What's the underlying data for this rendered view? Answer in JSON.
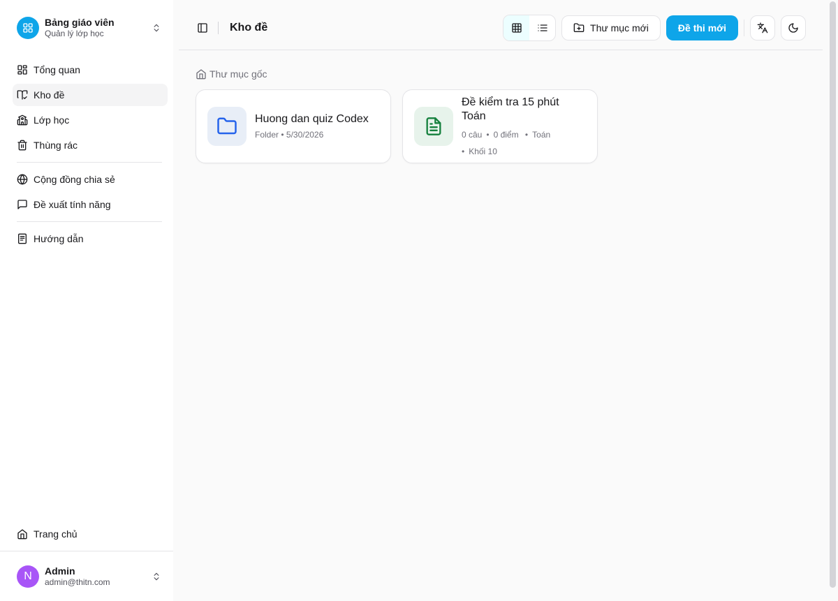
{
  "brand": {
    "title": "Bảng giáo viên",
    "subtitle": "Quản lý lớp học",
    "color": "#0ea5e9"
  },
  "sidebar": {
    "items": [
      {
        "label": "Tổng quan",
        "icon": "dashboard-icon"
      },
      {
        "label": "Kho đề",
        "icon": "book-check-icon",
        "active": true
      },
      {
        "label": "Lớp học",
        "icon": "school-icon"
      },
      {
        "label": "Thùng rác",
        "icon": "trash-icon"
      },
      {
        "label": "Cộng đồng chia sẻ",
        "icon": "globe-icon"
      },
      {
        "label": "Đề xuất tính năng",
        "icon": "message-icon"
      },
      {
        "label": "Hướng dẫn",
        "icon": "notebook-icon"
      }
    ],
    "home": {
      "label": "Trang chủ",
      "icon": "home-icon"
    }
  },
  "user": {
    "initial": "N",
    "name": "Admin",
    "email": "admin@thitn.com",
    "avatar_color": "#a855f7"
  },
  "header": {
    "title": "Kho đề",
    "new_folder": "Thư mục mới",
    "new_exam": "Đề thi mới"
  },
  "breadcrumb": {
    "root": "Thư mục gốc"
  },
  "items": [
    {
      "type": "folder",
      "title": "Huong dan quiz Codex",
      "kind": "Folder",
      "date": "5/30/2026"
    },
    {
      "type": "exam",
      "title": "Đề kiểm tra 15 phút Toán",
      "questions": "0 câu",
      "points": "0 điểm",
      "subject": "Toán",
      "grade": "Khối 10"
    }
  ],
  "colors": {
    "accent": "#0ea5e9",
    "folder_icon": "#2563eb",
    "doc_icon": "#15803d"
  }
}
